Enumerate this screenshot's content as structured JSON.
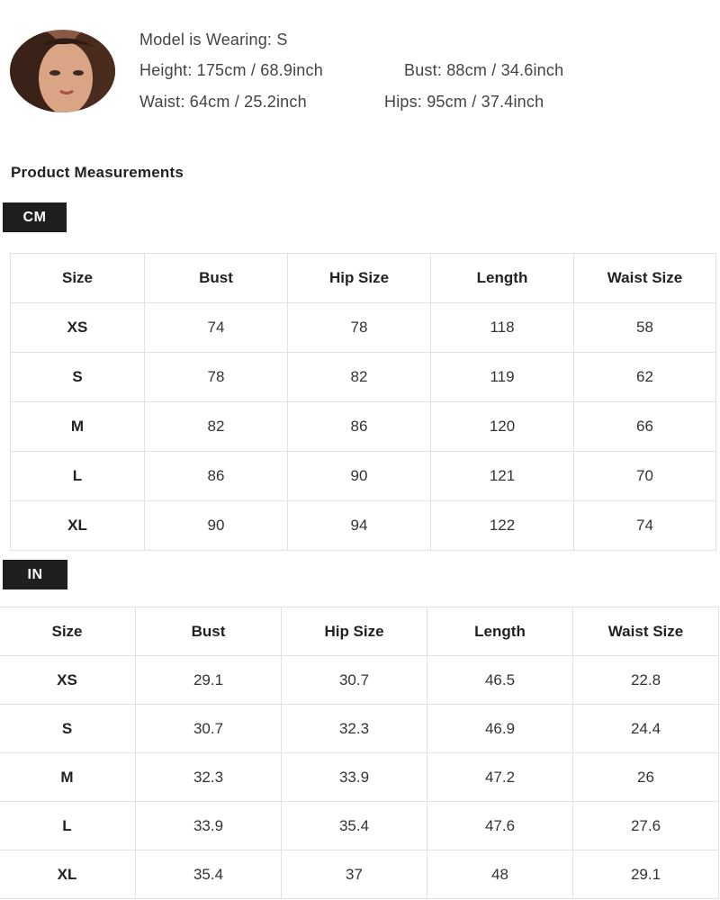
{
  "model": {
    "avatar_icon": "model-portrait",
    "wearing": "Model is Wearing: S",
    "height": "Height: 175cm / 68.9inch",
    "bust": "Bust: 88cm / 34.6inch",
    "waist": "Waist: 64cm / 25.2inch",
    "hips": "Hips: 95cm / 37.4inch"
  },
  "product_measurements": {
    "title": "Product Measurements",
    "cm": {
      "label": "CM",
      "headers": [
        "Size",
        "Bust",
        "Hip Size",
        "Length",
        "Waist Size"
      ],
      "rows": [
        [
          "XS",
          "74",
          "78",
          "118",
          "58"
        ],
        [
          "S",
          "78",
          "82",
          "119",
          "62"
        ],
        [
          "M",
          "82",
          "86",
          "120",
          "66"
        ],
        [
          "L",
          "86",
          "90",
          "121",
          "70"
        ],
        [
          "XL",
          "90",
          "94",
          "122",
          "74"
        ]
      ]
    },
    "in": {
      "label": "IN",
      "headers": [
        "Size",
        "Bust",
        "Hip Size",
        "Length",
        "Waist Size"
      ],
      "rows": [
        [
          "XS",
          "29.1",
          "30.7",
          "46.5",
          "22.8"
        ],
        [
          "S",
          "30.7",
          "32.3",
          "46.9",
          "24.4"
        ],
        [
          "M",
          "32.3",
          "33.9",
          "47.2",
          "26"
        ],
        [
          "L",
          "33.9",
          "35.4",
          "47.6",
          "27.6"
        ],
        [
          "XL",
          "35.4",
          "37",
          "48",
          "29.1"
        ]
      ]
    }
  },
  "colors": {
    "badge_background": "#1f1f1f",
    "table_border": "#e2e2e2"
  }
}
